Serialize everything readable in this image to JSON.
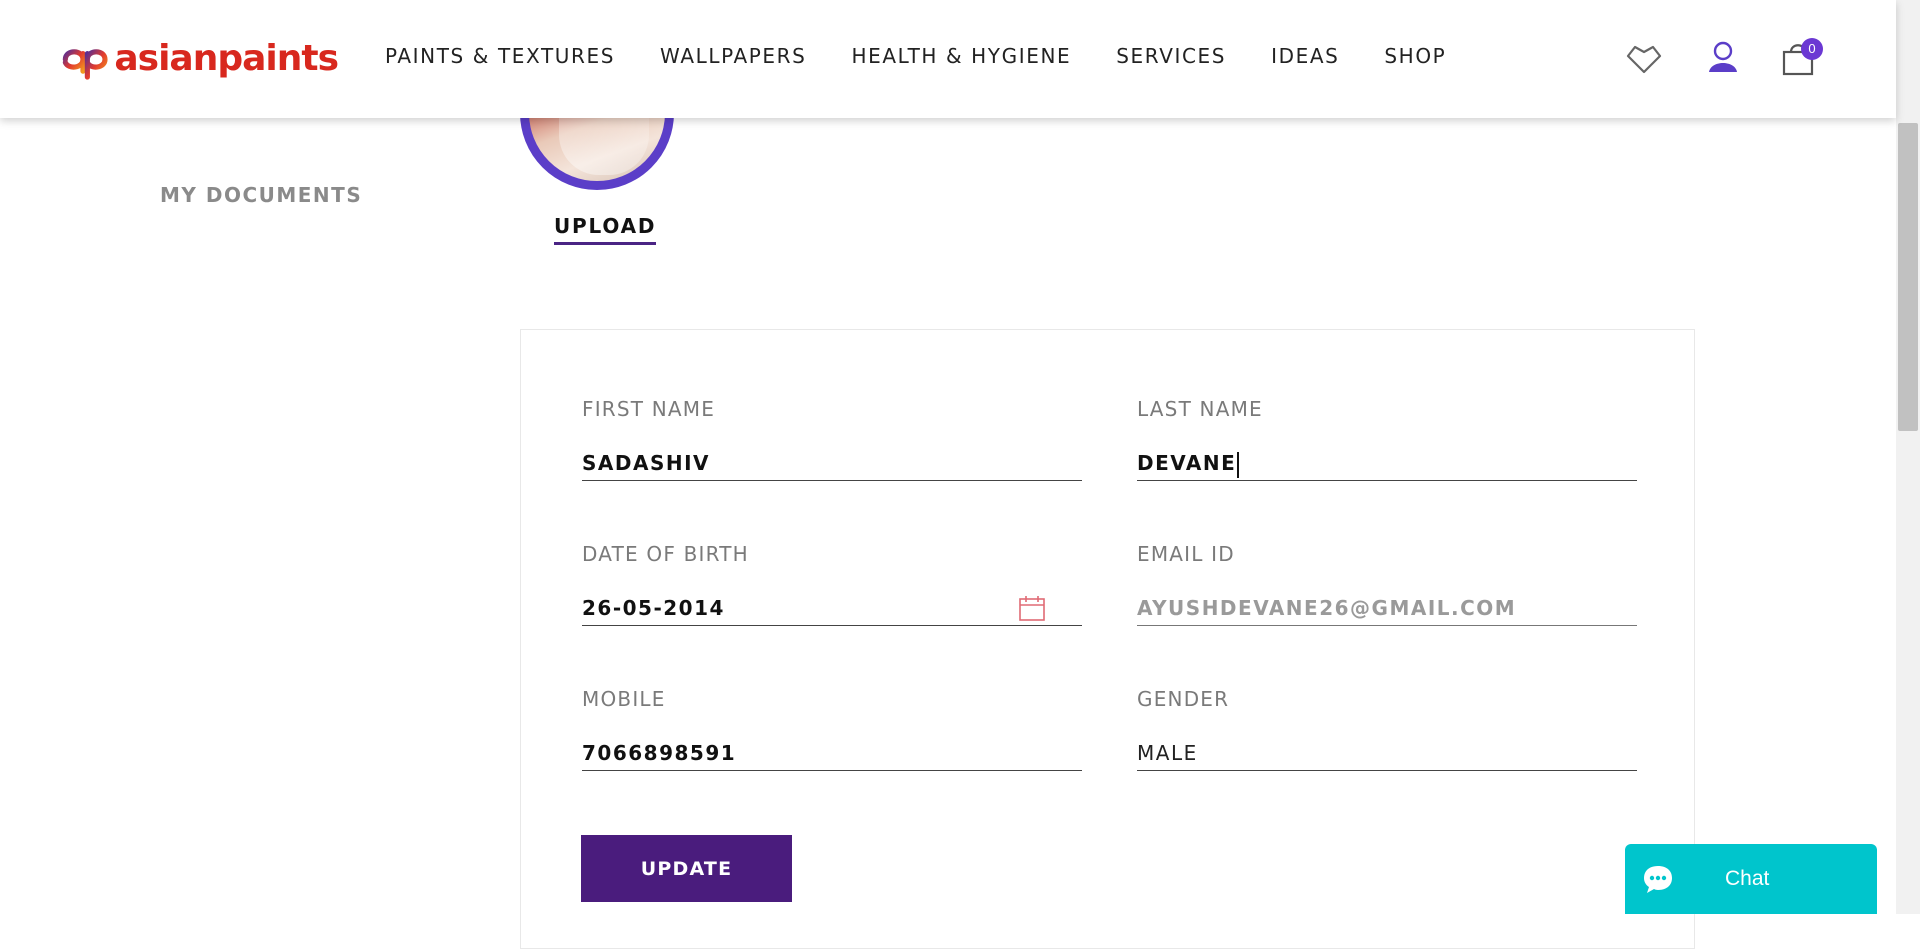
{
  "header": {
    "logo_text": "asianpaints",
    "nav": [
      "PAINTS & TEXTURES",
      "WALLPAPERS",
      "HEALTH & HYGIENE",
      "SERVICES",
      "IDEAS",
      "SHOP"
    ],
    "cart_count": "0"
  },
  "sidebar": {
    "my_documents": "MY DOCUMENTS"
  },
  "profile": {
    "upload_label": "UPLOAD"
  },
  "form": {
    "first_name": {
      "label": "FIRST NAME",
      "value": "SADASHIV"
    },
    "last_name": {
      "label": "LAST NAME",
      "value": "DEVANE"
    },
    "dob": {
      "label": "DATE OF BIRTH",
      "value": "26-05-2014"
    },
    "email": {
      "label": "EMAIL ID",
      "value": "AYUSHDEVANE26@GMAIL.COM"
    },
    "mobile": {
      "label": "MOBILE",
      "value": "7066898591"
    },
    "gender": {
      "label": "GENDER",
      "value": "MALE"
    },
    "update_label": "UPDATE"
  },
  "chat": {
    "label": "Chat"
  },
  "colors": {
    "brand_purple": "#4a1c7d",
    "accent_purple": "#5b3ec8",
    "logo_red": "#d8281e",
    "chat_teal": "#00c5cc",
    "badge_purple": "#6b38d3"
  }
}
